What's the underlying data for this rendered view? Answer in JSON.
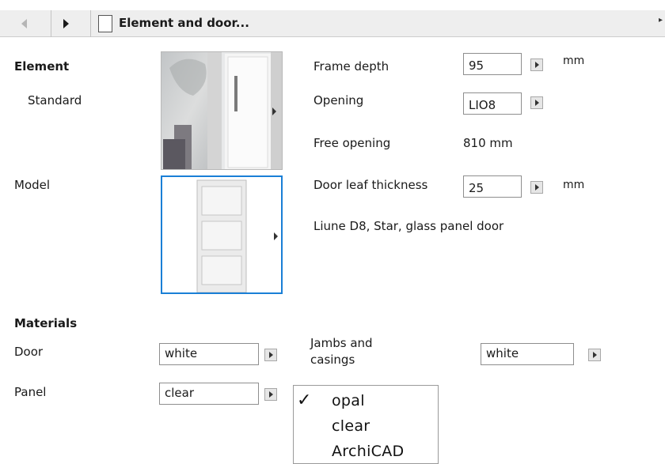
{
  "header": {
    "title": "Element and door..."
  },
  "element": {
    "section_label": "Element",
    "value": "Standard"
  },
  "model": {
    "label": "Model"
  },
  "properties": {
    "frame_depth_label": "Frame depth",
    "frame_depth_value": "95",
    "frame_depth_unit": "mm",
    "opening_label": "Opening",
    "opening_value": "LIO8",
    "free_opening_label": "Free opening",
    "free_opening_value": "810 mm",
    "leaf_thickness_label": "Door leaf thickness",
    "leaf_thickness_value": "25",
    "leaf_thickness_unit": "mm",
    "model_description": "Liune D8, Star, glass panel door"
  },
  "materials": {
    "section_label": "Materials",
    "door_label": "Door",
    "door_value": "white",
    "panel_label": "Panel",
    "panel_value": "clear",
    "jambs_label_line1": "Jambs and",
    "jambs_label_line2": "casings",
    "jambs_value": "white"
  },
  "popup": {
    "checkmark": "✓",
    "items": [
      "opal",
      "clear",
      "ArchiCAD"
    ],
    "selected": "opal"
  },
  "icons": {
    "back": "back-arrow-icon",
    "forward": "forward-arrow-icon",
    "menu_arrow": "menu-arrow-icon",
    "checkmark": "checkmark-icon"
  }
}
